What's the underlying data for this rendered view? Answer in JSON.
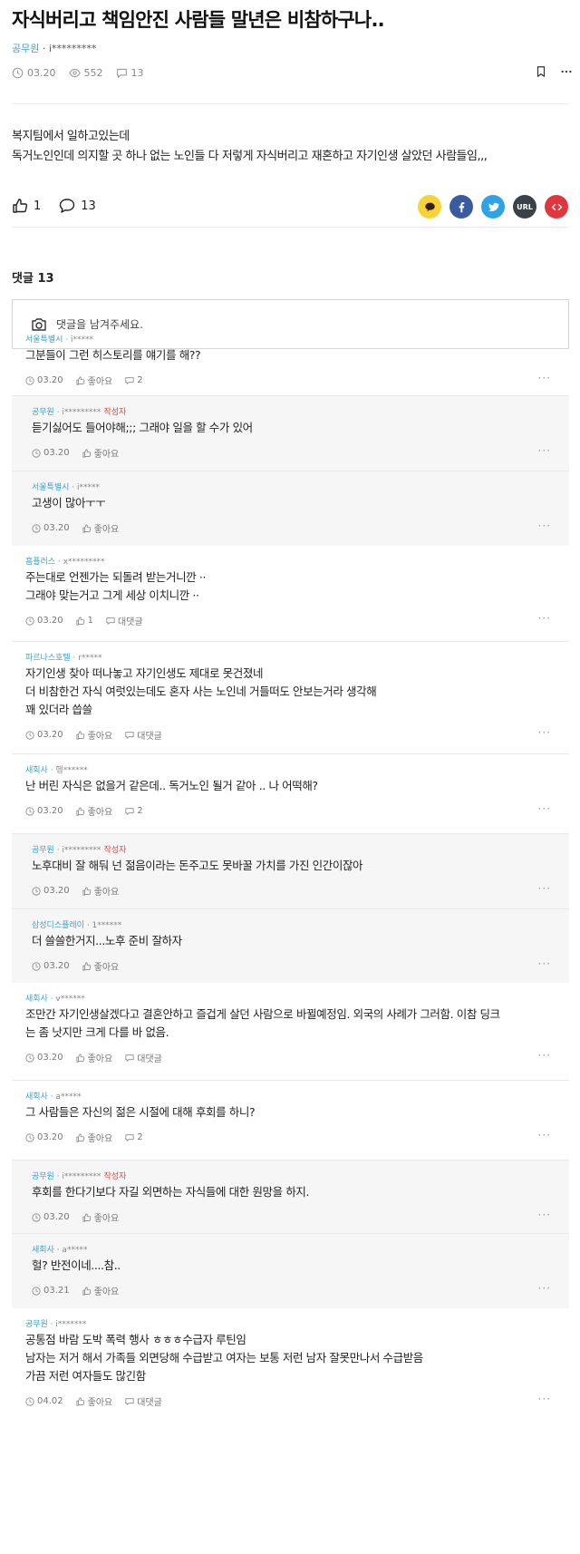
{
  "post": {
    "title": "자식버리고 책임안진 사람들 말년은 비참하구나..",
    "company": "공무원",
    "author": " · i*********",
    "date": "03.20",
    "views": "552",
    "comments": "13",
    "body": [
      "복지팀에서 일하고있는데",
      "독거노인인데 의지할 곳 하나 없는 노인들 다 저렇게 자식버리고 재혼하고 자기인생 살았던 사람들임,,,"
    ],
    "likes": "1",
    "comment_count": "13",
    "share": {
      "kakao_color": "#f7d33a",
      "facebook_color": "#3b5ba0",
      "twitter_color": "#2fa3e6",
      "url_label": "URL",
      "url_color": "#3b4148",
      "embed_color": "#e0373f"
    }
  },
  "comments_section": {
    "title": "댓글 13",
    "input_placeholder": "댓글을 남겨주세요."
  },
  "comments": [
    {
      "company": "서울특별시",
      "author": " · i*****",
      "op": "",
      "lines": [
        "그분들이 그런 히스토리를 얘기를 해??"
      ],
      "date": "03.20",
      "like": "좋아요",
      "reply": "2"
    },
    {
      "company": "공무원",
      "author": " · i*********",
      "op": "작성자",
      "lines": [
        "듣기싫어도 들어야해;;; 그래야 일을 할 수가 있어"
      ],
      "date": "03.20",
      "like": "좋아요",
      "reply": ""
    },
    {
      "company": "서울특별시",
      "author": " · i*****",
      "op": "",
      "lines": [
        "고생이 많아ㅜㅜ"
      ],
      "date": "03.20",
      "like": "좋아요",
      "reply": ""
    },
    {
      "company": "흠플러스",
      "author": " · x*********",
      "op": "",
      "lines": [
        "주는대로 언젠가는 되돌려 받는거니깐 ··",
        "그래야 맞는거고 그게 세상 이치니깐 ··"
      ],
      "date": "03.20",
      "like": "1",
      "reply": "대댓글"
    },
    {
      "company": "파르나스호텔",
      "author": " · r*****",
      "op": "",
      "lines": [
        "자기인생 찾아 떠나놓고 자기인생도 제대로 못건졌네",
        "더 비참한건 자식 여럿있는데도 혼자 사는 노인네 거들떠도 안보는거라 생각해",
        "꽤 있더라 씁쓸"
      ],
      "date": "03.20",
      "like": "좋아요",
      "reply": "대댓글"
    },
    {
      "company": "새회사",
      "author": " · 헹******",
      "op": "",
      "lines": [
        "난 버린 자식은 없을거 같은데.. 독거노인 될거 같아 .. 나 어떡해?"
      ],
      "date": "03.20",
      "like": "좋아요",
      "reply": "2"
    },
    {
      "company": "공무원",
      "author": " · i*********",
      "op": "작성자",
      "lines": [
        "노후대비 잘 해둬 넌 젊음이라는 돈주고도 못바꿀 가치를 가진 인간이잖아"
      ],
      "date": "03.20",
      "like": "좋아요",
      "reply": ""
    },
    {
      "company": "삼성디스플레이",
      "author": " · 1******",
      "op": "",
      "lines": [
        "더 쓸쓸한거지...노후 준비 잘하자"
      ],
      "date": "03.20",
      "like": "좋아요",
      "reply": ""
    },
    {
      "company": "새회사",
      "author": " · v******",
      "op": "",
      "lines": [
        "조만간 자기인생살겠다고 결혼안하고 즐겁게 살던 사람으로 바뀔예정임. 외국의 사례가 그러함. 이참 딩크",
        "는 좀 낫지만 크게 다를 바 없음."
      ],
      "date": "03.20",
      "like": "좋아요",
      "reply": "대댓글"
    },
    {
      "company": "새회사",
      "author": " · a*****",
      "op": "",
      "lines": [
        "그 사람들은 자신의 젊은 시절에 대해 후회를 하니?"
      ],
      "date": "03.20",
      "like": "좋아요",
      "reply": "2"
    },
    {
      "company": "공무원",
      "author": " · i*********",
      "op": "작성자",
      "lines": [
        "후회를 한다기보다 자길 외면하는 자식들에 대한 원망을 하지."
      ],
      "date": "03.20",
      "like": "좋아요",
      "reply": ""
    },
    {
      "company": "새회사",
      "author": " · a*****",
      "op": "",
      "lines": [
        "헐? 반전이네....참.."
      ],
      "date": "03.21",
      "like": "좋아요",
      "reply": ""
    },
    {
      "company": "공무원",
      "author": " · i*******",
      "op": "",
      "lines": [
        "공통점 바람 도박 폭력 행사 ㅎㅎㅎ수급자 루틴임",
        "남자는 저거 해서 가족들 외면당해 수급받고 여자는 보통 저런 남자 잘못만나서 수급받음",
        "가끔 저런 여자들도 많긴함"
      ],
      "date": "04.02",
      "like": "좋아요",
      "reply": "대댓글"
    }
  ]
}
